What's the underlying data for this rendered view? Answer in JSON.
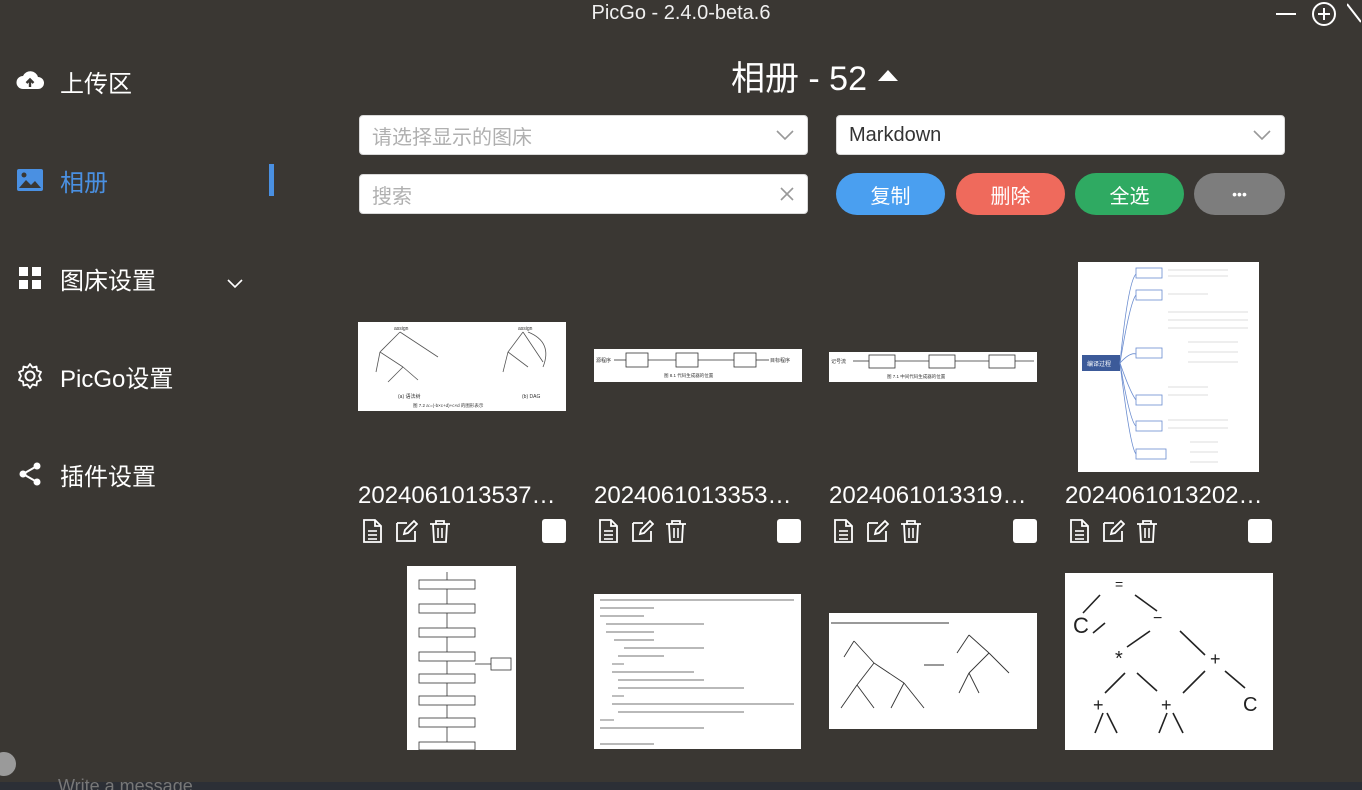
{
  "window": {
    "title": "PicGo - 2.4.0-beta.6"
  },
  "sidebar": {
    "items": [
      {
        "label": "上传区",
        "icon": "cloud-upload-icon"
      },
      {
        "label": "相册",
        "icon": "image-icon",
        "active": true
      },
      {
        "label": "图床设置",
        "icon": "grid-icon"
      },
      {
        "label": "PicGo设置",
        "icon": "gear-icon"
      },
      {
        "label": "插件设置",
        "icon": "share-icon"
      }
    ]
  },
  "gallery": {
    "title": "相册 - 52",
    "bed_select": {
      "placeholder": "请选择显示的图床"
    },
    "format_select": {
      "value": "Markdown"
    },
    "search": {
      "placeholder": "搜索"
    },
    "buttons": {
      "copy": "复制",
      "delete": "删除",
      "select_all": "全选",
      "more": "•••"
    },
    "images": [
      {
        "name": "2024061013537…"
      },
      {
        "name": "2024061013353…"
      },
      {
        "name": "2024061013319…"
      },
      {
        "name": "2024061013202…"
      }
    ]
  },
  "composer": {
    "placeholder": "Write a message"
  },
  "colors": {
    "background": "#3a3733",
    "accent": "#4a90e2",
    "copy": "#4a9ff0",
    "delete": "#ef6a5c",
    "select_all": "#2faa62",
    "more": "#7d7d7d"
  }
}
